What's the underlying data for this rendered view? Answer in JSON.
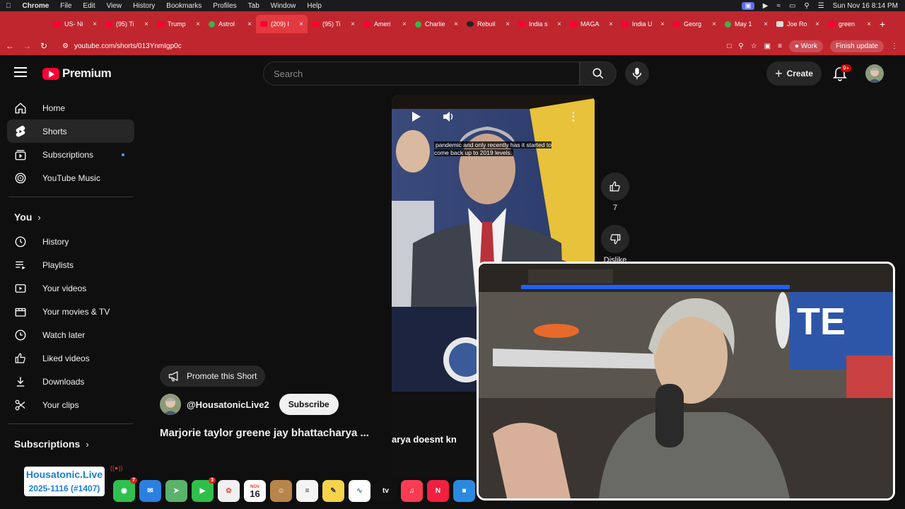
{
  "menubar": {
    "app": "Chrome",
    "items": [
      "File",
      "Edit",
      "View",
      "History",
      "Bookmarks",
      "Profiles",
      "Tab",
      "Window",
      "Help"
    ],
    "datetime": "Sun Nov 16  8:14 PM"
  },
  "tabs": [
    {
      "title": "US- Ni",
      "fav": "yt"
    },
    {
      "title": "(95) Ti",
      "fav": "yt"
    },
    {
      "title": "Trump",
      "fav": "yt"
    },
    {
      "title": "Astrol",
      "fav": "green"
    },
    {
      "title": "(209) I",
      "fav": "yt",
      "active": true
    },
    {
      "title": "(95) Ti",
      "fav": "yt"
    },
    {
      "title": "Ameri",
      "fav": "yt"
    },
    {
      "title": "Charlie",
      "fav": "green"
    },
    {
      "title": "Rebuil",
      "fav": "dark"
    },
    {
      "title": "India s",
      "fav": "yt"
    },
    {
      "title": "MAGA",
      "fav": "yt"
    },
    {
      "title": "India U",
      "fav": "yt"
    },
    {
      "title": "Georg",
      "fav": "yt"
    },
    {
      "title": "May 1",
      "fav": "green"
    },
    {
      "title": "Joe Ro",
      "fav": "nyt"
    },
    {
      "title": "green",
      "fav": "yt"
    }
  ],
  "urlbar": {
    "url": "youtube.com/shorts/013YnmIgp0c",
    "profile": "Work",
    "update_label": "Finish update"
  },
  "header": {
    "logo_text": "Premium",
    "search_placeholder": "Search",
    "create_label": "Create",
    "notif_badge": "9+"
  },
  "sidebar": {
    "main": [
      {
        "label": "Home",
        "icon": "home-icon"
      },
      {
        "label": "Shorts",
        "icon": "shorts-icon",
        "active": true
      },
      {
        "label": "Subscriptions",
        "icon": "subscriptions-icon",
        "dot": true
      },
      {
        "label": "YouTube Music",
        "icon": "music-icon"
      }
    ],
    "you_heading": "You",
    "you": [
      {
        "label": "History",
        "icon": "history-icon"
      },
      {
        "label": "Playlists",
        "icon": "playlists-icon"
      },
      {
        "label": "Your videos",
        "icon": "your-videos-icon"
      },
      {
        "label": "Your movies & TV",
        "icon": "movies-icon"
      },
      {
        "label": "Watch later",
        "icon": "clock-icon"
      },
      {
        "label": "Liked videos",
        "icon": "thumbs-up-icon"
      },
      {
        "label": "Downloads",
        "icon": "download-icon"
      },
      {
        "label": "Your clips",
        "icon": "scissors-icon"
      }
    ],
    "subscriptions_heading": "Subscriptions"
  },
  "short": {
    "caption": "pandemic and only recently has it started to come back up to 2019 levels.",
    "lower_caption": "arya doesnt kn",
    "like_count": "7",
    "dislike_label": "Dislike",
    "promote_label": "Promote this Short",
    "channel": "@HousatonicLive2",
    "subscribe_label": "Subscribe",
    "title": "Marjorie taylor greene jay bhattacharya ..."
  },
  "overlay": {
    "line1": "Housatonic.Live",
    "line2": "2025-1116 (#1407)"
  },
  "dock": {
    "calendar_month": "NOV",
    "calendar_day": "16",
    "messages_badge": "7",
    "facetime_badge": "3"
  },
  "colors": {
    "chrome_red": "#c0262e",
    "yt_red": "#ff0033",
    "bg": "#0f0f0f"
  }
}
